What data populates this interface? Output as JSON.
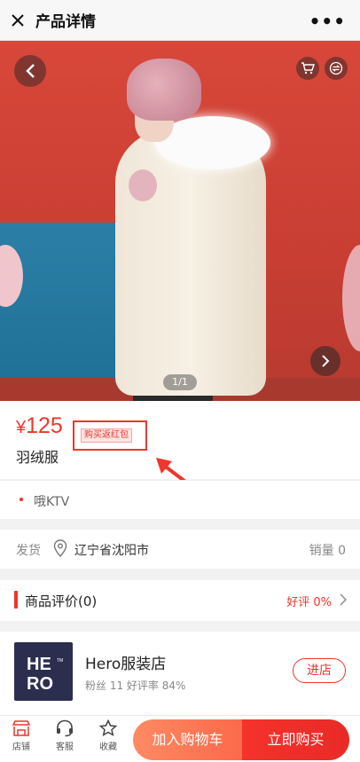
{
  "topbar": {
    "title": "产品详情",
    "more": "•••"
  },
  "gallery": {
    "pager": "1/1"
  },
  "product": {
    "currency": "¥",
    "price": "125",
    "tag": "购买返红包",
    "name": "羽绒服"
  },
  "shop_tag": "哦KTV",
  "shipping": {
    "label": "发货",
    "location": "辽宁省沈阳市",
    "sales": "销量 0"
  },
  "reviews": {
    "title": "商品评价(0)",
    "good_rate": "好评 0%"
  },
  "shop": {
    "logo_text": "HERO",
    "name": "Hero服装店",
    "stats": "粉丝 11  好评率 84%",
    "enter_label": "进店"
  },
  "bottom_bar": {
    "store_label": "店铺",
    "service_label": "客服",
    "favorite_label": "收藏",
    "add_cart_label": "加入购物车",
    "buy_now_label": "立即购买"
  },
  "colors": {
    "accent": "#f0352b",
    "cart_button": "#fb6a4a",
    "shop_logo_bg": "#2b2e4e"
  }
}
